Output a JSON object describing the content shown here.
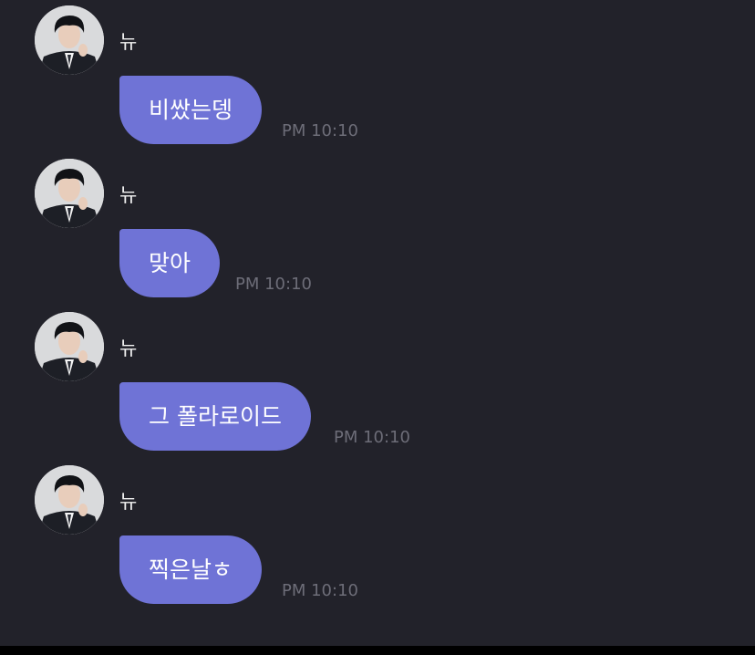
{
  "chat": {
    "messages": [
      {
        "sender": "뉴",
        "text": "비쌌는뎅",
        "time": "PM 10:10"
      },
      {
        "sender": "뉴",
        "text": "맞아",
        "time": "PM 10:10"
      },
      {
        "sender": "뉴",
        "text": "그 폴라로이드",
        "time": "PM 10:10"
      },
      {
        "sender": "뉴",
        "text": "찍은날ㅎ",
        "time": "PM 10:10"
      }
    ]
  },
  "colors": {
    "background": "#22222a",
    "bubble": "#6f73d6",
    "bubble_text": "#ffffff",
    "sender_text": "#f2f2f2",
    "time_text": "#6d6d78",
    "bottom_bar": "#000000"
  },
  "icons": {
    "avatar": "profile-photo-avatar"
  }
}
